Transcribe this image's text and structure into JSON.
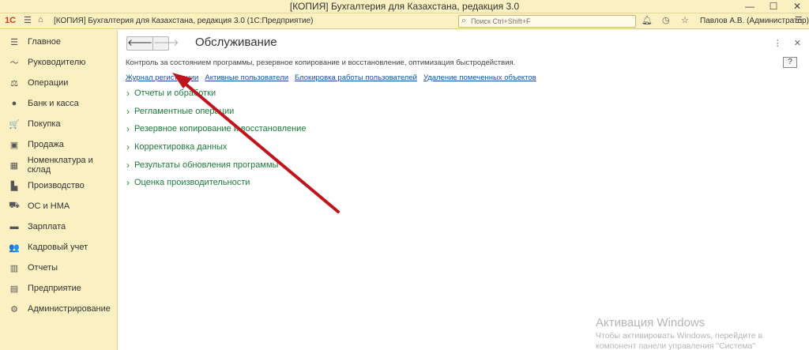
{
  "window": {
    "title": "[КОПИЯ] Бухгалтерия для Казахстана, редакция 3.0",
    "controls": [
      "—",
      "☐",
      "✕"
    ]
  },
  "toolbar": {
    "logo": "1С",
    "app_name": "[КОПИЯ] Бухгалтерия для Казахстана, редакция 3.0  (1С:Предприятие)",
    "search_placeholder": "Поиск Ctrl+Shift+F",
    "user": "Павлов А.В. (Администратор)"
  },
  "sidebar": {
    "items": [
      {
        "label": "Главное",
        "icon": "☰"
      },
      {
        "label": "Руководителю",
        "icon": "〜"
      },
      {
        "label": "Операции",
        "icon": "⚖"
      },
      {
        "label": "Банк и касса",
        "icon": "●"
      },
      {
        "label": "Покупка",
        "icon": "🛒"
      },
      {
        "label": "Продажа",
        "icon": "▣"
      },
      {
        "label": "Номенклатура и склад",
        "icon": "▦"
      },
      {
        "label": "Производство",
        "icon": "▙"
      },
      {
        "label": "ОС и НМА",
        "icon": "⛟"
      },
      {
        "label": "Зарплата",
        "icon": "▬"
      },
      {
        "label": "Кадровый учет",
        "icon": "👥"
      },
      {
        "label": "Отчеты",
        "icon": "▥"
      },
      {
        "label": "Предприятие",
        "icon": "▤"
      },
      {
        "label": "Администрирование",
        "icon": "⚙"
      }
    ]
  },
  "main": {
    "title": "Обслуживание",
    "description": "Контроль за состоянием программы, резервное копирование и восстановление, оптимизация быстродействия.",
    "help_label": "?",
    "links": [
      "Журнал регистрации",
      "Активные пользователи",
      "Блокировка работы пользователей",
      "Удаление помеченных объектов"
    ],
    "groups": [
      "Отчеты и обработки",
      "Регламентные операции",
      "Резервное копирование и восстановление",
      "Корректировка данных",
      "Результаты обновления программы",
      "Оценка производительности"
    ]
  },
  "watermark": {
    "title": "Активация Windows",
    "text_line1": "Чтобы активировать Windows, перейдите в",
    "text_line2": "компонент панели управления \"Система\""
  },
  "colors": {
    "panel_bg": "#fbf0c2",
    "link": "#1a4fa8",
    "group_green": "#1d7a3a",
    "arrow_red": "#c0141c"
  }
}
